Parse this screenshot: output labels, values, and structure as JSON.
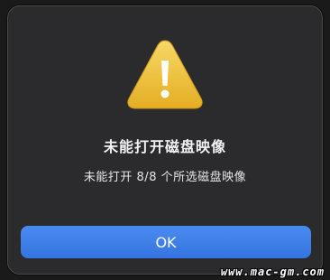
{
  "dialog": {
    "title": "未能打开磁盘映像",
    "message": "未能打开 8/8 个所选磁盘映像",
    "ok_label": "OK",
    "icon": "warning-triangle-icon"
  },
  "watermark": "www.mac-gm.com",
  "colors": {
    "dialog_background": "#2b2b2d",
    "button_accent": "#3d7ee8",
    "warning_yellow": "#f0c53a"
  }
}
